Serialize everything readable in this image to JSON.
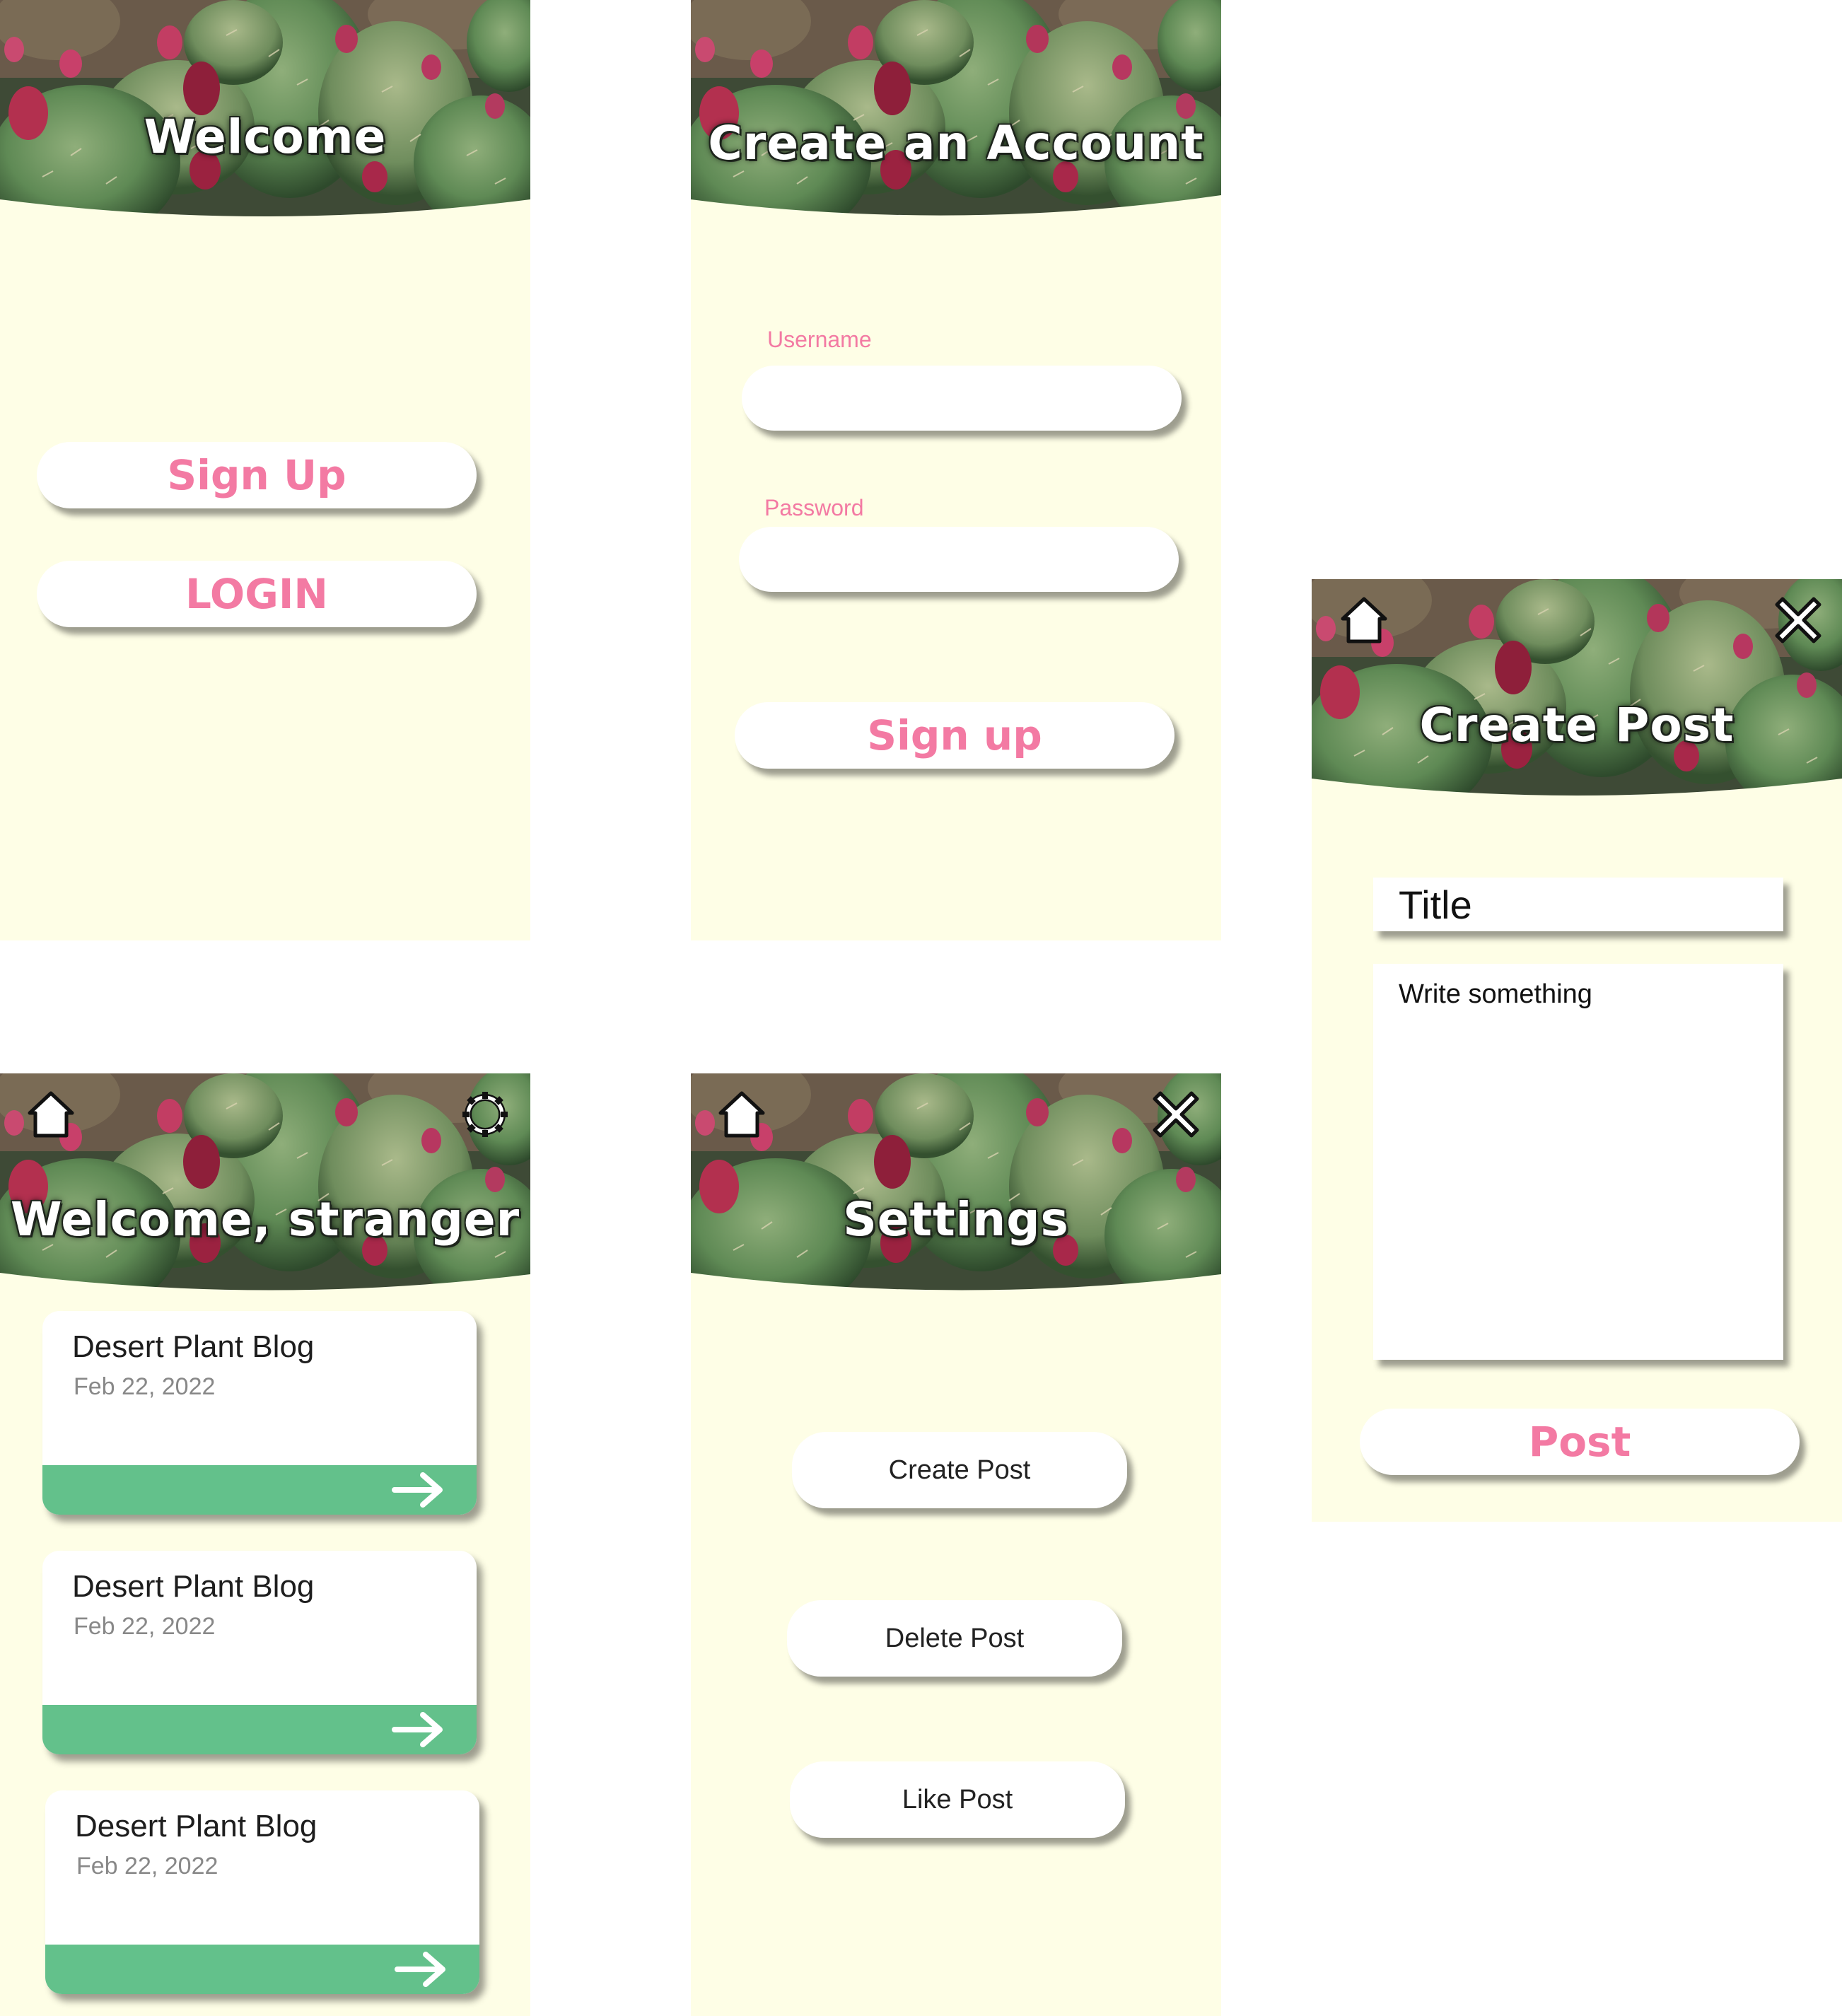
{
  "welcome": {
    "title": "Welcome",
    "signup_label": "Sign Up",
    "login_label": "LOGIN"
  },
  "signup": {
    "title": "Create an Account",
    "username_label": "Username",
    "username_value": "",
    "password_label": "Password",
    "password_value": "",
    "submit_label": "Sign up"
  },
  "feed": {
    "title": "Welcome, stranger",
    "posts": [
      {
        "title": "Desert Plant Blog",
        "date": "Feb 22, 2022"
      },
      {
        "title": "Desert Plant Blog",
        "date": "Feb 22, 2022"
      },
      {
        "title": "Desert Plant Blog",
        "date": "Feb 22, 2022"
      }
    ]
  },
  "settings": {
    "title": "Settings",
    "create_label": "Create Post",
    "delete_label": "Delete Post",
    "like_label": "Like Post"
  },
  "create": {
    "title": "Create Post",
    "title_placeholder": "Title",
    "body_placeholder": "Write something",
    "submit_label": "Post"
  },
  "icons": {
    "home": "home-icon",
    "settings": "gear-icon",
    "close": "close-icon",
    "arrow": "arrow-right-icon"
  },
  "colors": {
    "accent": "#f37aa3",
    "card_bar": "#63c18b",
    "background": "#fefee6"
  }
}
